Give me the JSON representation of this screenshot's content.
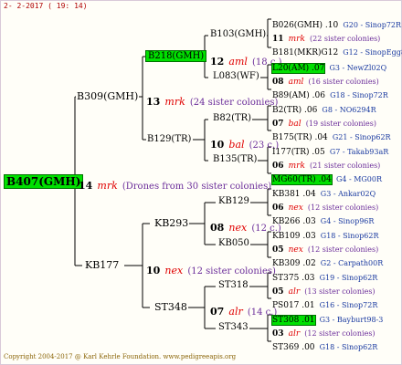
{
  "date": "2- 2-2017 ( 19: 14)",
  "footer": "Copyright 2004-2017 @ Karl Kehrle Foundation.   www.pedigreeapis.org",
  "root": {
    "name": "B407(GMH)",
    "num": "14",
    "race": "mrk",
    "count": "(Drones from 30 sister colonies)"
  },
  "gen1": [
    {
      "name": "B309(GMH)",
      "num": "13",
      "race": "mrk",
      "count": "(24 sister colonies)"
    },
    {
      "name": "KB177",
      "num": "10",
      "race": "nex",
      "count": "(12 sister colonies)"
    }
  ],
  "gen2": [
    {
      "name": "B218(GMH)",
      "num": "12",
      "race": "aml",
      "count": "(18 c.)"
    },
    {
      "name": "B129(TR)",
      "num": "10",
      "race": "bal",
      "count": "(23 c.)"
    },
    {
      "name": "KB293",
      "num": "08",
      "race": "nex",
      "count": "(12 c.)"
    },
    {
      "name": "ST348",
      "num": "07",
      "race": "alr",
      "count": "(14 c.)"
    }
  ],
  "gen3": [
    {
      "name": "B103(GMH)"
    },
    {
      "name": "L083(WF)"
    },
    {
      "name": "B82(TR)"
    },
    {
      "name": "B135(TR)"
    },
    {
      "name": "KB129"
    },
    {
      "name": "KB050"
    },
    {
      "name": "ST318"
    },
    {
      "name": "ST343"
    }
  ],
  "gen4": [
    {
      "top": {
        "name": "B026(GMH) .10",
        "ref": "G20 - Sinop72R",
        "green": false
      },
      "mid": {
        "num": "11",
        "race": "mrk",
        "count": "(22 sister colonies)"
      },
      "bottom": {
        "name": "B181(MKR)G12",
        "ref": "G12 - SinopEgg86R",
        "green": false
      }
    },
    {
      "top": {
        "name": "L20(AM) .07",
        "ref": "G3 - NewZl02Q",
        "green": true
      },
      "mid": {
        "num": "08",
        "race": "aml",
        "count": "(16 sister colonies)"
      },
      "bottom": {
        "name": "B89(AM) .06",
        "ref": "G18 - Sinop72R",
        "green": false
      }
    },
    {
      "top": {
        "name": "B2(TR) .06",
        "ref": "G8 - NO6294R",
        "green": false
      },
      "mid": {
        "num": "07",
        "race": "bal",
        "count": "(19 sister colonies)"
      },
      "bottom": {
        "name": "B175(TR) .04",
        "ref": "G21 - Sinop62R",
        "green": false
      }
    },
    {
      "top": {
        "name": "I177(TR) .05",
        "ref": "G7 - Takab93aR",
        "green": false
      },
      "mid": {
        "num": "06",
        "race": "mrk",
        "count": "(21 sister colonies)"
      },
      "bottom": {
        "name": "MG60(TR) .04",
        "ref": "G4 - MG00R",
        "green": true
      }
    },
    {
      "top": {
        "name": "KB381 .04",
        "ref": "G3 - Ankar02Q",
        "green": false
      },
      "mid": {
        "num": "06",
        "race": "nex",
        "count": "(12 sister colonies)"
      },
      "bottom": {
        "name": "KB266 .03",
        "ref": "G4 - Sinop96R",
        "green": false
      }
    },
    {
      "top": {
        "name": "KB109 .03",
        "ref": "G18 - Sinop62R",
        "green": false
      },
      "mid": {
        "num": "05",
        "race": "nex",
        "count": "(12 sister colonies)"
      },
      "bottom": {
        "name": "KB309 .02",
        "ref": "G2 - Carpath00R",
        "green": false
      }
    },
    {
      "top": {
        "name": "ST375 .03",
        "ref": "G19 - Sinop62R",
        "green": false
      },
      "mid": {
        "num": "05",
        "race": "alr",
        "count": "(13 sister colonies)"
      },
      "bottom": {
        "name": "PS017 .01",
        "ref": "G16 - Sinop72R",
        "green": false
      }
    },
    {
      "top": {
        "name": "ST308 .01",
        "ref": "G3 - Bayburt98-3",
        "green": true
      },
      "mid": {
        "num": "03",
        "race": "alr",
        "count": "(12 sister colonies)"
      },
      "bottom": {
        "name": "ST369 .00",
        "ref": "G18 - Sinop62R",
        "green": false
      }
    }
  ]
}
